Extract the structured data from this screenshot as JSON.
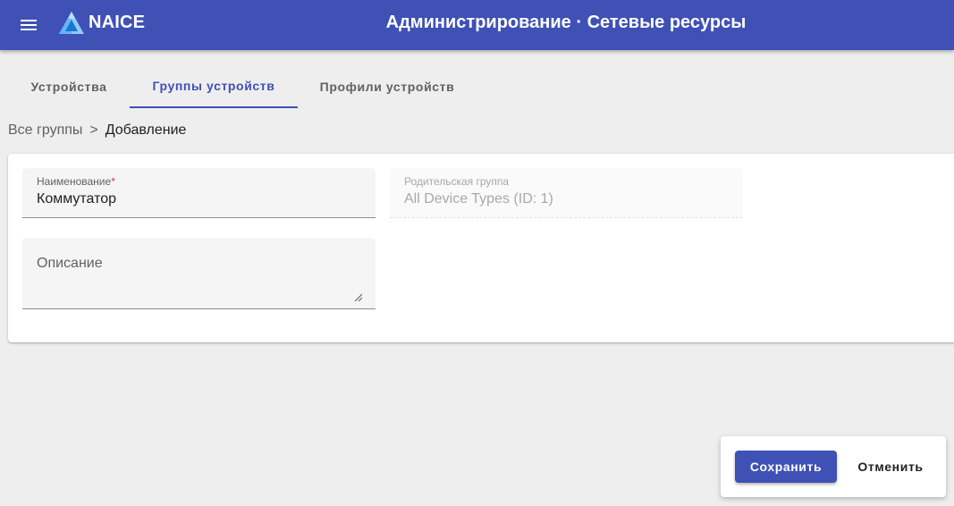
{
  "header": {
    "brand": "NAICE",
    "title": "Администрирование · Сетевые ресурсы",
    "bar_color": "#3f51b5",
    "menu_icon": "hamburger-menu-icon",
    "logo_icon": "naice-logo-icon"
  },
  "tabs": [
    {
      "label": "Устройства",
      "active": false
    },
    {
      "label": "Группы устройств",
      "active": true
    },
    {
      "label": "Профили устройств",
      "active": false
    }
  ],
  "breadcrumb": {
    "root": "Все группы",
    "separator": ">",
    "current": "Добавление"
  },
  "form": {
    "name": {
      "label": "Наименование",
      "required_mark": "*",
      "value": "Коммутатор"
    },
    "parent_group": {
      "label": "Родительская группа",
      "value": "All Device Types (ID: 1)",
      "disabled": true
    },
    "description": {
      "placeholder": "Описание",
      "value": ""
    }
  },
  "actions": {
    "save_label": "Сохранить",
    "cancel_label": "Отменить"
  }
}
